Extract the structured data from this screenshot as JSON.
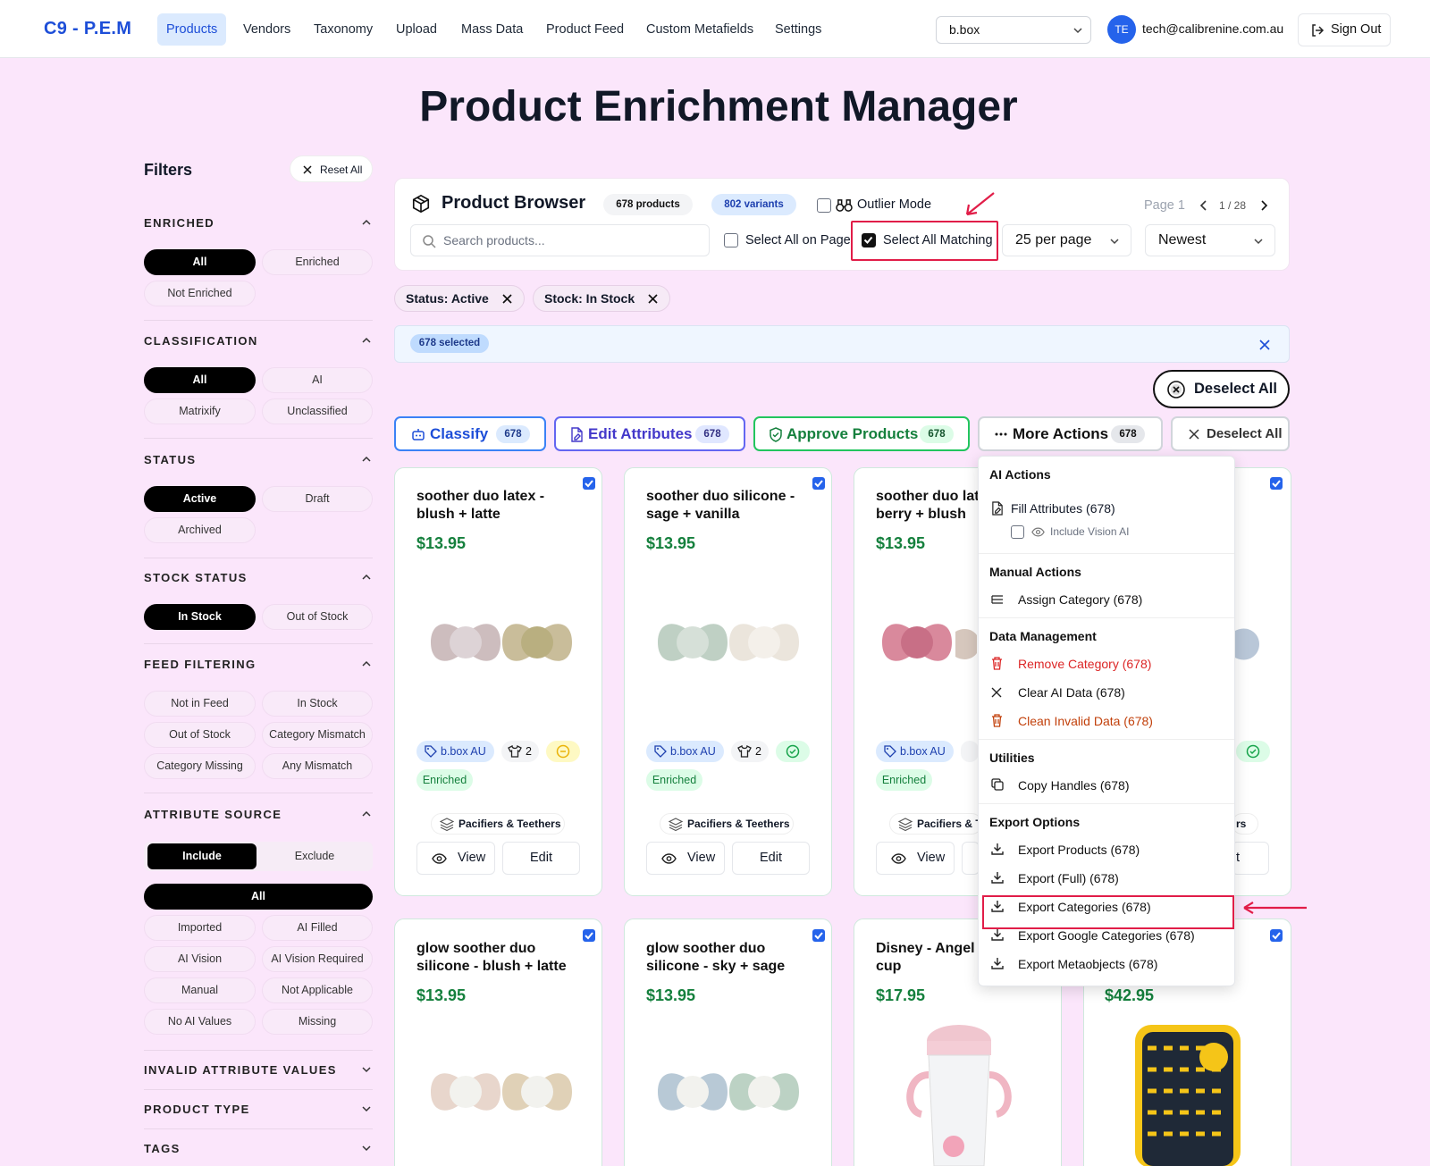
{
  "nav": {
    "brand": "C9 - P.E.M",
    "links": [
      "Products",
      "Vendors",
      "Taxonomy",
      "Upload",
      "Mass Data",
      "Product Feed",
      "Custom Metafields",
      "Settings"
    ],
    "store": "b.box",
    "avatar": "TE",
    "email": "tech@calibrenine.com.au",
    "signout": "Sign Out"
  },
  "page_title": "Product Enrichment Manager",
  "filters": {
    "title": "Filters",
    "reset": "Reset All",
    "enriched": {
      "title": "ENRICHED",
      "options": [
        "All",
        "Enriched",
        "Not Enriched"
      ],
      "selected": "All"
    },
    "classification": {
      "title": "CLASSIFICATION",
      "options": [
        "All",
        "AI",
        "Matrixify",
        "Unclassified"
      ],
      "selected": "All"
    },
    "status": {
      "title": "STATUS",
      "options": [
        "Active",
        "Draft",
        "Archived"
      ],
      "selected": "Active"
    },
    "stock": {
      "title": "STOCK STATUS",
      "options": [
        "In Stock",
        "Out of Stock"
      ],
      "selected": "In Stock"
    },
    "feed": {
      "title": "FEED FILTERING",
      "options": [
        "Not in Feed",
        "In Stock",
        "Out of Stock",
        "Category Mismatch",
        "Category Missing",
        "Any Mismatch"
      ]
    },
    "attr_source": {
      "title": "ATTRIBUTE SOURCE",
      "mode": [
        "Include",
        "Exclude"
      ],
      "mode_selected": "Include",
      "all": "All",
      "options": [
        "Imported",
        "AI Filled",
        "AI Vision",
        "AI Vision Required",
        "Manual",
        "Not Applicable",
        "No AI Values",
        "Missing"
      ]
    },
    "invalid": "INVALID ATTRIBUTE VALUES",
    "product_type": "PRODUCT TYPE",
    "tags": "TAGS"
  },
  "browser": {
    "title": "Product Browser",
    "products_badge": "678 products",
    "variants_badge": "802 variants",
    "outlier": "Outlier Mode",
    "page_label": "Page 1",
    "page_pos": "1 / 28",
    "search_placeholder": "Search products...",
    "select_page": "Select All on Page",
    "select_matching": "Select All Matching",
    "per_page": "25 per page",
    "sort": "Newest"
  },
  "chips": [
    {
      "label": "Status: Active"
    },
    {
      "label": "Stock: In Stock"
    }
  ],
  "selected_badge": "678 selected",
  "deselect_all": "Deselect All",
  "actions": {
    "classify": "Classify",
    "edit": "Edit Attributes",
    "approve": "Approve Products",
    "more": "More Actions",
    "count": "678",
    "deselect": "Deselect All"
  },
  "products": [
    {
      "name1": "soother duo latex -",
      "name2": "blush + latte",
      "price": "$13.95",
      "vendor": "b.box AU",
      "variants": "2",
      "status": "Enriched",
      "category": "Pacifiers & Teethers",
      "view": "View",
      "edit": "Edit",
      "c1": "#cdbdbe",
      "c2": "#c9bd9a",
      "ring": "#eab308"
    },
    {
      "name1": "soother duo silicone -",
      "name2": "sage + vanilla",
      "price": "$13.95",
      "vendor": "b.box AU",
      "variants": "2",
      "status": "Enriched",
      "category": "Pacifiers & Teethers",
      "view": "View",
      "edit": "Edit",
      "c1": "#bfd0c4",
      "c2": "#ebe5dc",
      "ring": "#16a34a"
    },
    {
      "name1": "soother duo lat",
      "name2": "berry + blush",
      "price": "$13.95",
      "vendor": "b.box AU",
      "variants": "",
      "status": "Enriched",
      "category": "Pacifiers & T",
      "view": "View",
      "edit": "",
      "c1": "#d9899c",
      "c2": "#d6c7bd",
      "ring": ""
    },
    {
      "name1": "",
      "name2": "",
      "price": "",
      "vendor": "",
      "variants": "",
      "status": "",
      "category": "rs",
      "view": "",
      "edit": "t",
      "c1": "#b9c7d8",
      "c2": "",
      "ring": "#16a34a"
    },
    {
      "name1": "glow soother duo",
      "name2": "silicone - blush + latte",
      "price": "$13.95",
      "c1": "#e8d6cc",
      "c2": "#e0d1b7"
    },
    {
      "name1": "glow soother duo",
      "name2": "silicone - sky + sage",
      "price": "$13.95",
      "c1": "#b8c9d6",
      "c2": "#bcd2c4"
    },
    {
      "name1": "Disney - Angel",
      "name2": "cup",
      "price": "$17.95"
    },
    {
      "name1": "",
      "name2": "",
      "price": "$42.95"
    }
  ],
  "menu": {
    "ai_head": "AI Actions",
    "fill": "Fill Attributes (678)",
    "vision": "Include Vision AI",
    "manual_head": "Manual Actions",
    "assign": "Assign Category (678)",
    "data_head": "Data Management",
    "remove": "Remove Category (678)",
    "clear": "Clear AI Data (678)",
    "clean": "Clean Invalid Data (678)",
    "util_head": "Utilities",
    "copy": "Copy Handles (678)",
    "export_head": "Export Options",
    "exp_products": "Export Products (678)",
    "exp_full": "Export (Full) (678)",
    "exp_categories": "Export Categories (678)",
    "exp_google": "Export Google Categories (678)",
    "exp_meta": "Export Metaobjects (678)"
  },
  "colors": {
    "accent": "#2563eb",
    "green": "#15803d",
    "danger": "#e11d48",
    "bg": "#fbe6fb"
  }
}
